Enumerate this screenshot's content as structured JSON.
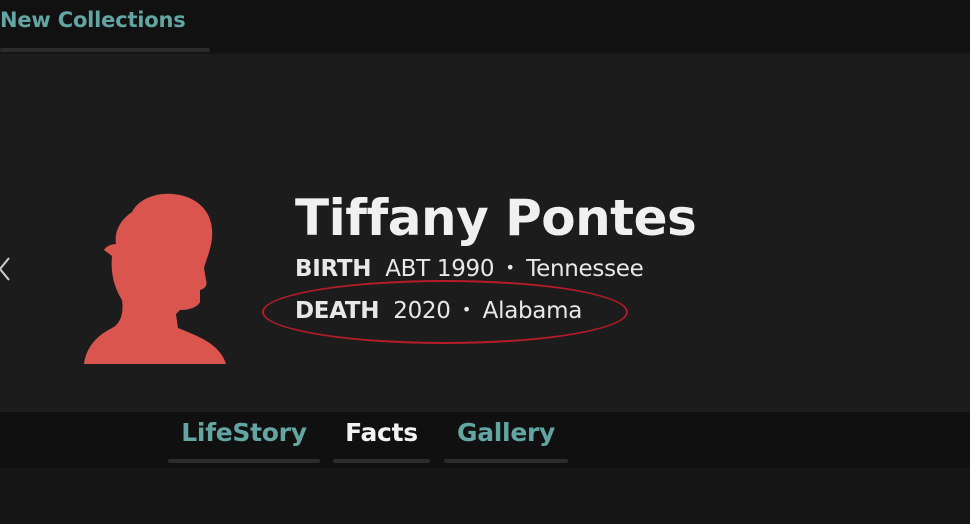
{
  "top_nav": {
    "collections_label": "New Collections"
  },
  "profile": {
    "name": "Tiffany Pontes",
    "birth": {
      "label": "BIRTH",
      "date": "ABT 1990",
      "separator": "•",
      "place": "Tennessee"
    },
    "death": {
      "label": "DEATH",
      "date": "2020",
      "separator": "•",
      "place": "Alabama"
    },
    "avatar_icon": "person-silhouette-icon",
    "avatar_color": "#d9554e"
  },
  "tabs": [
    {
      "label": "LifeStory",
      "color": "#62a5a3",
      "active": false
    },
    {
      "label": "Facts",
      "color": "#f2f2f2",
      "active": true
    },
    {
      "label": "Gallery",
      "color": "#62a5a3",
      "active": false
    }
  ],
  "annotation": {
    "highlight_color": "#b41c28",
    "highlighted_row": "death"
  },
  "icons": {
    "prev": "chevron-left-icon"
  }
}
